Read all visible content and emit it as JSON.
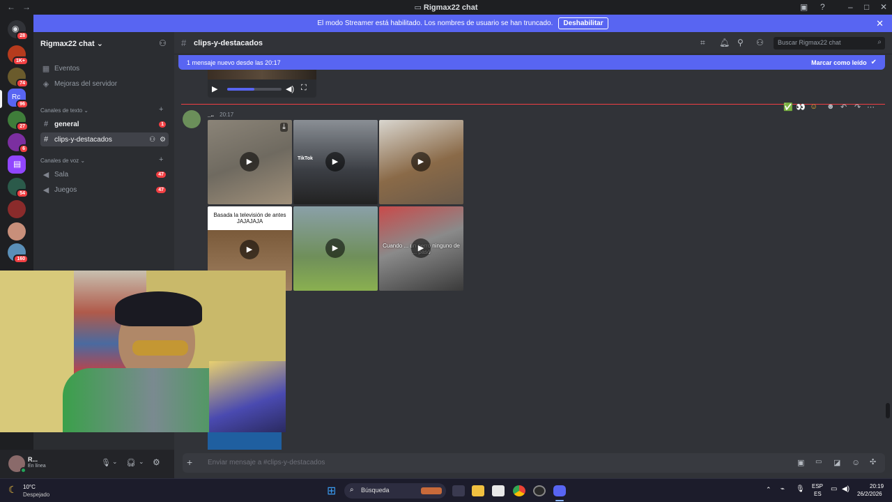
{
  "window": {
    "title": "Rigmax22 chat"
  },
  "banner": {
    "text": "El modo Streamer está habilitado. Los nombres de usuario se han truncado.",
    "button": "Deshabilitar"
  },
  "servers": [
    {
      "badge": "28"
    },
    {
      "badge": "1K+"
    },
    {
      "badge": "74"
    },
    {
      "badge": "96"
    },
    {
      "badge": "27"
    },
    {
      "badge": "6"
    },
    {
      "badge": ""
    },
    {
      "badge": "54"
    },
    {
      "badge": ""
    },
    {
      "badge": ""
    },
    {
      "badge": "160"
    }
  ],
  "sidebar": {
    "server_name": "Rigmax22 chat",
    "top_items": [
      "Eventos",
      "Mejoras del servidor"
    ],
    "text_category": "Canales de texto",
    "text_channels": [
      {
        "name": "general",
        "count": "1"
      },
      {
        "name": "clips-y-destacados",
        "count": ""
      }
    ],
    "voice_category": "Canales de voz",
    "voice_channels": [
      {
        "name": "Sala",
        "count": "47"
      },
      {
        "name": "Juegos",
        "count": "47"
      }
    ]
  },
  "channel": {
    "name": "clips-y-destacados",
    "search_placeholder": "Buscar Rigmax22 chat"
  },
  "new_messages": {
    "text": "1 mensaje nuevo desde las 20:17",
    "mark_read": "Marcar como leído"
  },
  "message": {
    "author": "_..",
    "time": "20:17",
    "captions": {
      "tiktok": "TikTok",
      "clip4": "Basada la televisión de antes JAJAJAJA",
      "clip6": "Cuando ... un perro ninguno de ... pasó"
    }
  },
  "composer": {
    "placeholder": "Enviar mensaje a #clips-y-destacados"
  },
  "user": {
    "name": "R...",
    "status": "En línea"
  },
  "taskbar": {
    "weather_temp": "10°C",
    "weather_desc": "Despejado",
    "search": "Búsqueda",
    "lang_top": "ESP",
    "lang_bottom": "ES",
    "time": "20:19",
    "date": "26/2/2026"
  },
  "colors": {
    "accent": "#5865f2",
    "danger": "#f23f43",
    "online": "#23a55a"
  }
}
